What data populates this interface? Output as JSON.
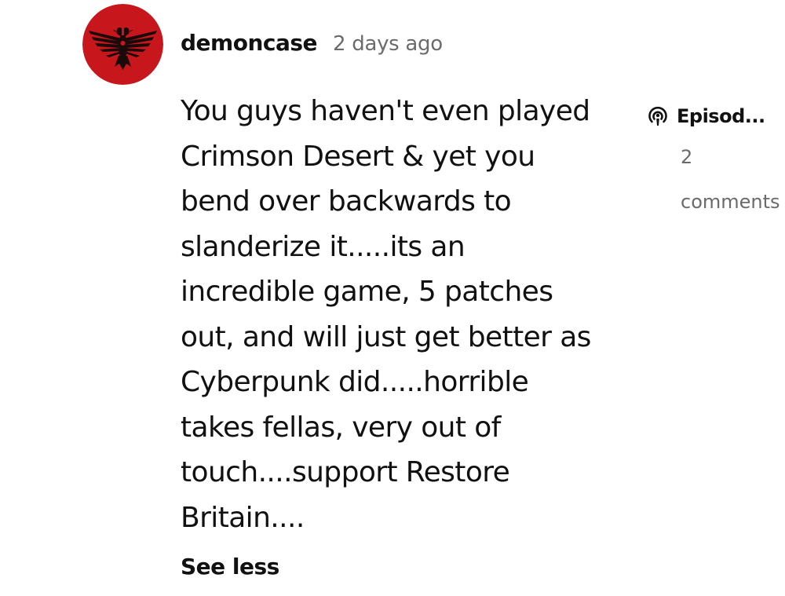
{
  "comment": {
    "avatar_icon": "imperial-eagle-icon",
    "avatar_color": "#c8161d",
    "username": "demoncase",
    "timestamp": "2 days ago",
    "body": "You guys haven't even played\nCrimson Desert & yet you\nbend over backwards to\nslanderize it.....its an\nincredible game, 5 patches\nout, and will just get better as\nCyberpunk did.....horrible\ntakes fellas, very out of\ntouch....support Restore\nBritain....",
    "toggle_label": "See less"
  },
  "episode": {
    "icon": "podcast-icon",
    "title": "Episod...",
    "count": "2",
    "count_label": "comments"
  }
}
